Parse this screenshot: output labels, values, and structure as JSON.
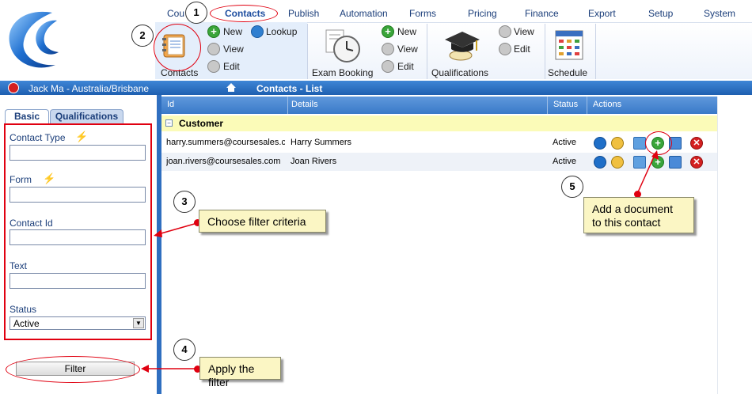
{
  "top_nav": [
    "Cou",
    "Contacts",
    "Publish",
    "Automation",
    "Forms",
    "Pricing",
    "Finance",
    "Export",
    "Setup",
    "System"
  ],
  "toolbar": {
    "contacts_label": "Contacts",
    "new": "New",
    "lookup": "Lookup",
    "view": "View",
    "edit": "Edit",
    "exam_booking": "Exam Booking",
    "new2": "New",
    "view2": "View",
    "edit2": "Edit",
    "qualifications": "Qualifications",
    "view3": "View",
    "edit3": "Edit",
    "schedule": "Schedule"
  },
  "status_bar": {
    "user": "Jack Ma - Australia/Brisbane",
    "page_title": "Contacts - List"
  },
  "filter_panel": {
    "tabs": [
      "Basic",
      "Qualifications"
    ],
    "contact_type_label": "Contact Type",
    "form_label": "Form",
    "contact_id_label": "Contact Id",
    "text_label": "Text",
    "status_label": "Status",
    "status_value": "Active",
    "filter_button": "Filter"
  },
  "table": {
    "columns": [
      "Id",
      "Details",
      "Status",
      "Actions"
    ],
    "group": "Customer",
    "rows": [
      {
        "id": "harry.summers@coursesales.c",
        "details": "Harry Summers",
        "status": "Active"
      },
      {
        "id": "joan.rivers@coursesales.com",
        "details": "Joan Rivers",
        "status": "Active"
      }
    ]
  },
  "annotations": {
    "n1": "1",
    "n2": "2",
    "n3": "3",
    "n4": "4",
    "n5": "5",
    "callout3": "Choose filter criteria",
    "callout4": "Apply the filter",
    "callout5_line1": "Add a document",
    "callout5_line2": "to this contact"
  },
  "colors": {
    "accent_blue": "#1f5fb0",
    "header_blue": "#3a7ac8",
    "annotation_red": "#e00010",
    "group_yellow": "#fbfbb8"
  }
}
